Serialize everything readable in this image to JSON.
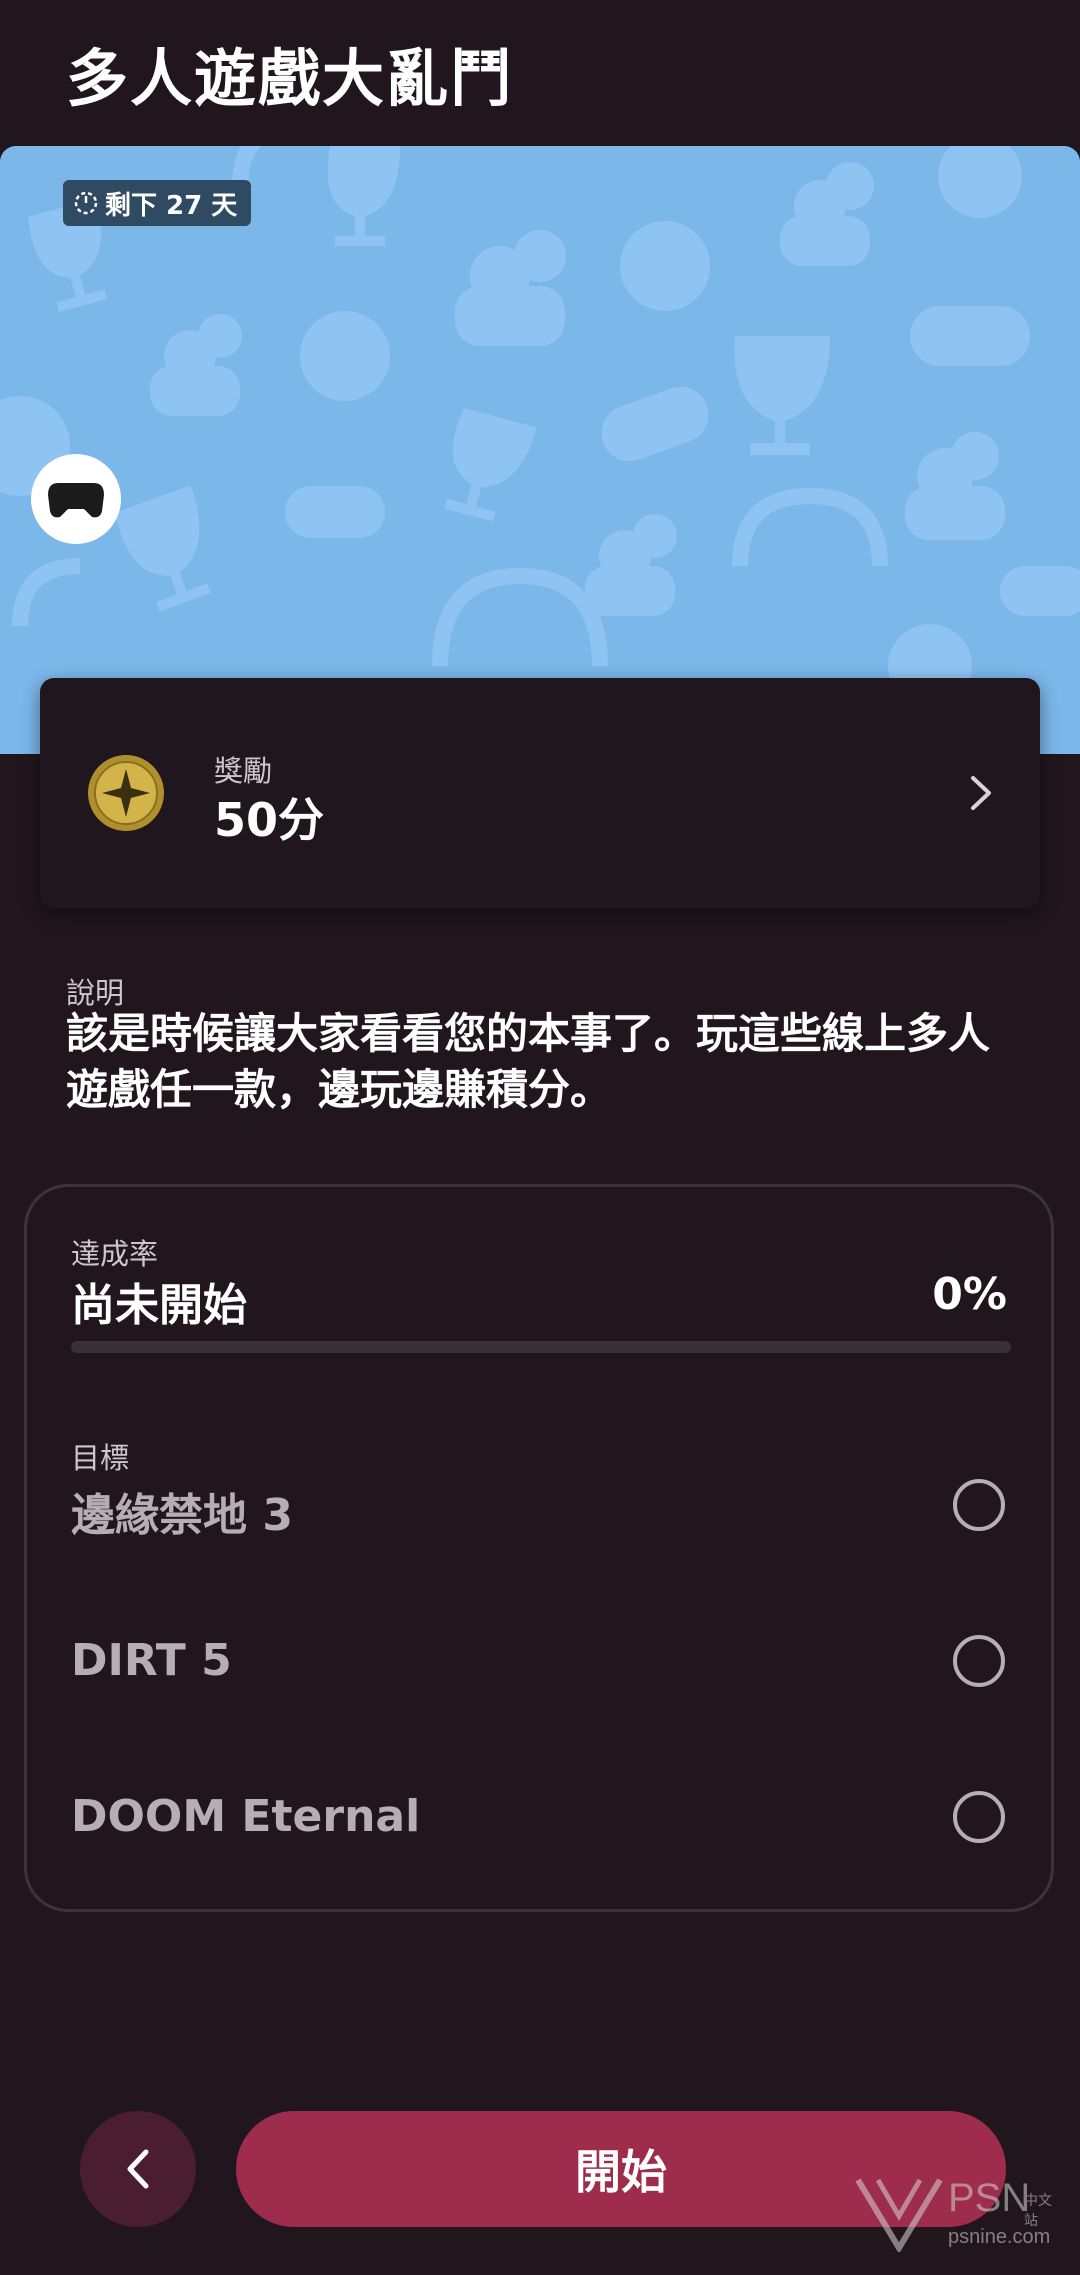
{
  "header": {
    "title": "多人遊戲大亂鬥"
  },
  "hero": {
    "days_left": "剩下 27 天",
    "background_color": "#7cb7ea",
    "pattern_icons": [
      "trophy-icon",
      "globe-icon",
      "controller-icon",
      "headset-icon",
      "hands-icon"
    ],
    "platform_icon": "gamepad-icon"
  },
  "reward": {
    "label": "獎勵",
    "value": "50分",
    "coin_icon": "star-coin-icon",
    "chevron_icon": "chevron-right-icon"
  },
  "description": {
    "label": "說明",
    "text": "該是時候讓大家看看您的本事了。玩這些線上多人遊戲任一款，邊玩邊賺積分。"
  },
  "progress": {
    "label": "達成率",
    "status": "尚未開始",
    "percent_text": "0%",
    "percent_value": 0,
    "accent_color": "#e0406e"
  },
  "goals": {
    "label": "目標",
    "items": [
      {
        "name": "邊緣禁地 3",
        "completed": false
      },
      {
        "name": "DIRT 5",
        "completed": false
      },
      {
        "name": "DOOM Eternal",
        "completed": false
      }
    ]
  },
  "footer": {
    "back_icon": "chevron-left-icon",
    "start_label": "開始",
    "start_color": "#9d2c4d"
  },
  "watermark": {
    "brand": "PSN",
    "brand_cn": "中文站",
    "url": "psnine.com"
  }
}
